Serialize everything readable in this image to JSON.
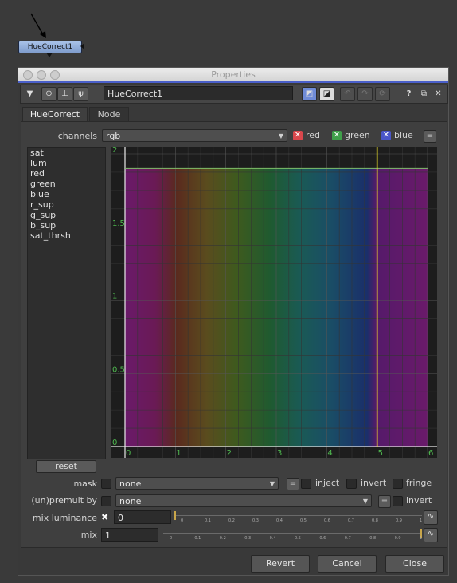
{
  "node": {
    "label": "HueCorrect1"
  },
  "window": {
    "title": "Properties"
  },
  "toolbar": {
    "node_name": "HueCorrect1",
    "help": "?"
  },
  "tabs": [
    {
      "label": "HueCorrect"
    },
    {
      "label": "Node"
    }
  ],
  "channels": {
    "label": "channels",
    "value": "rgb",
    "red": "red",
    "green": "green",
    "blue": "blue",
    "equals": "=",
    "colors": {
      "red": "#d9474c",
      "green": "#3fa04a",
      "blue": "#4a56c8"
    }
  },
  "curves": [
    "sat",
    "lum",
    "red",
    "green",
    "blue",
    "r_sup",
    "g_sup",
    "b_sup",
    "sat_thrsh"
  ],
  "reset_label": "reset",
  "graph": {
    "x_ticks": [
      "0",
      "1",
      "2",
      "3",
      "4",
      "5",
      "6"
    ],
    "y_ticks": [
      "2",
      "1.5",
      "1",
      "0.5",
      "0"
    ],
    "x_range": [
      0,
      6
    ],
    "y_range": [
      0,
      2
    ],
    "cursor_x": 5,
    "curve_value": 1.9,
    "cursor_color": "#f0e32a"
  },
  "mask": {
    "label": "mask",
    "value": "none",
    "equals": "=",
    "inject": "inject",
    "invert": "invert",
    "fringe": "fringe"
  },
  "premult": {
    "label": "(un)premult by",
    "value": "none",
    "equals": "=",
    "invert": "invert"
  },
  "mix_luminance": {
    "label": "mix luminance",
    "value": "0"
  },
  "mix": {
    "label": "mix",
    "value": "1"
  },
  "slider_ticks": [
    "0",
    "0.1",
    "0.2",
    "0.3",
    "0.4",
    "0.5",
    "0.6",
    "0.7",
    "0.8",
    "0.9",
    "1"
  ],
  "buttons": {
    "revert": "Revert",
    "cancel": "Cancel",
    "close": "Close"
  }
}
